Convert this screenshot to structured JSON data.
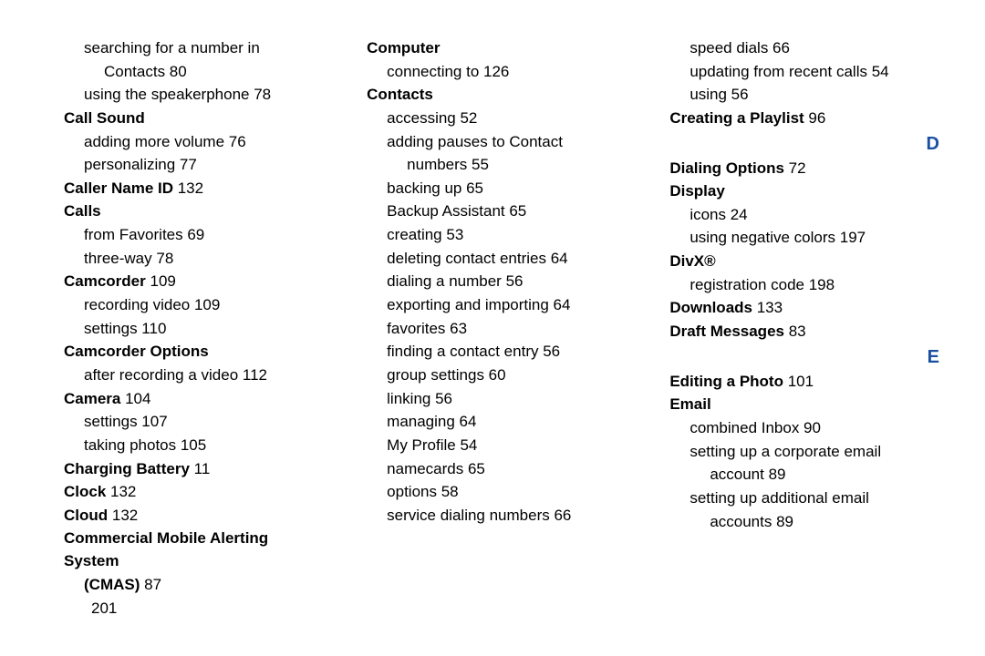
{
  "pageNumber": "201",
  "columns": [
    [
      {
        "type": "sub",
        "text": "searching for a number in"
      },
      {
        "type": "subsub",
        "text": "Contacts 80"
      },
      {
        "type": "sub",
        "text": "using the speakerphone 78"
      },
      {
        "type": "heading",
        "text": "Call Sound"
      },
      {
        "type": "sub",
        "text": "adding more volume 76"
      },
      {
        "type": "sub",
        "text": "personalizing 77"
      },
      {
        "type": "heading-page",
        "h": "Caller Name ID",
        "p": " 132"
      },
      {
        "type": "heading",
        "text": "Calls"
      },
      {
        "type": "sub",
        "text": "from Favorites 69"
      },
      {
        "type": "sub",
        "text": "three-way 78"
      },
      {
        "type": "heading-page",
        "h": "Camcorder",
        "p": " 109"
      },
      {
        "type": "sub",
        "text": "recording video 109"
      },
      {
        "type": "sub",
        "text": "settings 110"
      },
      {
        "type": "heading",
        "text": "Camcorder Options"
      },
      {
        "type": "sub",
        "text": "after recording a video 112"
      },
      {
        "type": "heading-page",
        "h": "Camera",
        "p": " 104"
      },
      {
        "type": "sub",
        "text": "settings 107"
      },
      {
        "type": "sub",
        "text": "taking photos 105"
      },
      {
        "type": "heading-page",
        "h": "Charging Battery",
        "p": " 11"
      },
      {
        "type": "heading-page",
        "h": "Clock",
        "p": " 132"
      },
      {
        "type": "heading-page",
        "h": "Cloud",
        "p": " 132"
      },
      {
        "type": "heading",
        "text": "Commercial Mobile Alerting System"
      },
      {
        "type": "sub-heading-page",
        "h": "(CMAS)",
        "p": " 87"
      }
    ],
    [
      {
        "type": "heading",
        "text": "Computer"
      },
      {
        "type": "sub",
        "text": "connecting to 126"
      },
      {
        "type": "heading",
        "text": "Contacts"
      },
      {
        "type": "sub",
        "text": "accessing 52"
      },
      {
        "type": "sub",
        "text": "adding pauses to Contact"
      },
      {
        "type": "subsub",
        "text": "numbers 55"
      },
      {
        "type": "sub",
        "text": "backing up 65"
      },
      {
        "type": "sub",
        "text": "Backup Assistant 65"
      },
      {
        "type": "sub",
        "text": "creating 53"
      },
      {
        "type": "sub",
        "text": "deleting contact entries 64"
      },
      {
        "type": "sub",
        "text": "dialing a number 56"
      },
      {
        "type": "sub",
        "text": "exporting and importing 64"
      },
      {
        "type": "sub",
        "text": "favorites 63"
      },
      {
        "type": "sub",
        "text": "finding a contact entry 56"
      },
      {
        "type": "sub",
        "text": "group settings 60"
      },
      {
        "type": "sub",
        "text": "linking 56"
      },
      {
        "type": "sub",
        "text": "managing 64"
      },
      {
        "type": "sub",
        "text": "My Profile 54"
      },
      {
        "type": "sub",
        "text": "namecards 65"
      },
      {
        "type": "sub",
        "text": "options 58"
      },
      {
        "type": "sub",
        "text": "service dialing numbers 66"
      }
    ],
    [
      {
        "type": "sub",
        "text": "speed dials 66"
      },
      {
        "type": "sub",
        "text": "updating from recent calls 54"
      },
      {
        "type": "sub",
        "text": "using 56"
      },
      {
        "type": "heading-page",
        "h": "Creating a Playlist",
        "p": " 96"
      },
      {
        "type": "letter",
        "text": "D"
      },
      {
        "type": "heading-page",
        "h": "Dialing Options",
        "p": " 72"
      },
      {
        "type": "heading",
        "text": "Display"
      },
      {
        "type": "sub",
        "text": "icons 24"
      },
      {
        "type": "sub",
        "text": "using negative colors 197"
      },
      {
        "type": "heading",
        "text": "DivX®"
      },
      {
        "type": "sub",
        "text": "registration code 198"
      },
      {
        "type": "heading-page",
        "h": "Downloads",
        "p": " 133"
      },
      {
        "type": "heading-page",
        "h": "Draft Messages",
        "p": " 83"
      },
      {
        "type": "letter",
        "text": "E"
      },
      {
        "type": "heading-page",
        "h": "Editing a Photo",
        "p": " 101"
      },
      {
        "type": "heading",
        "text": "Email"
      },
      {
        "type": "sub",
        "text": "combined Inbox 90"
      },
      {
        "type": "sub",
        "text": "setting up a corporate email"
      },
      {
        "type": "subsub",
        "text": "account 89"
      },
      {
        "type": "sub",
        "text": "setting up additional email"
      },
      {
        "type": "subsub",
        "text": "accounts 89"
      }
    ]
  ]
}
